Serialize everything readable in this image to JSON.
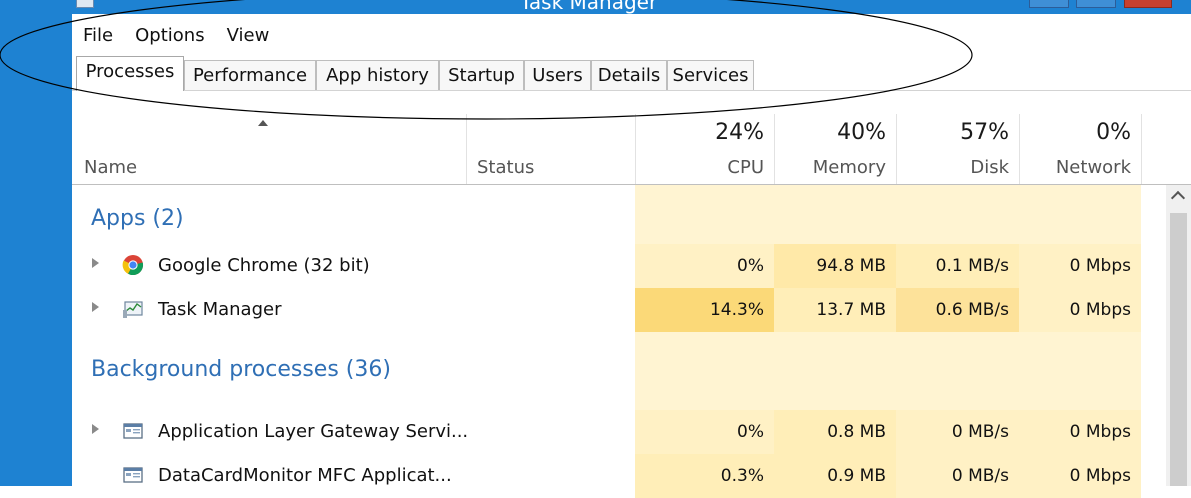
{
  "window": {
    "title": "Task Manager",
    "menu": [
      "File",
      "Options",
      "View"
    ],
    "tabs": [
      "Processes",
      "Performance",
      "App history",
      "Startup",
      "Users",
      "Details",
      "Services"
    ],
    "active_tab": "Processes"
  },
  "columns": {
    "name": "Name",
    "status": "Status",
    "cpu": {
      "label": "CPU",
      "pct": "24%"
    },
    "memory": {
      "label": "Memory",
      "pct": "40%"
    },
    "disk": {
      "label": "Disk",
      "pct": "57%"
    },
    "network": {
      "label": "Network",
      "pct": "0%"
    }
  },
  "groups": {
    "apps": "Apps (2)",
    "background": "Background processes (36)"
  },
  "processes": [
    {
      "name": "Google Chrome (32 bit)",
      "icon": "chrome-icon",
      "expandable": true,
      "cpu": "0%",
      "memory": "94.8 MB",
      "disk": "0.1 MB/s",
      "network": "0 Mbps"
    },
    {
      "name": "Task Manager",
      "icon": "task-manager-icon",
      "expandable": true,
      "cpu": "14.3%",
      "memory": "13.7 MB",
      "disk": "0.6 MB/s",
      "network": "0 Mbps"
    },
    {
      "name": "Application Layer Gateway Servi...",
      "icon": "service-window-icon",
      "expandable": true,
      "cpu": "0%",
      "memory": "0.8 MB",
      "disk": "0 MB/s",
      "network": "0 Mbps"
    },
    {
      "name": "DataCardMonitor MFC Applicat...",
      "icon": "service-window-icon",
      "expandable": false,
      "cpu": "0.3%",
      "memory": "0.9 MB",
      "disk": "0 MB/s",
      "network": "0 Mbps"
    }
  ],
  "colors": {
    "frame": "#1e82d2",
    "group_title": "#2f6fb5",
    "heat_light": "#fff4d2",
    "heat_medium": "#ffe9a8",
    "heat_strong": "#fbd978",
    "annotation_ellipse": "#000000"
  }
}
